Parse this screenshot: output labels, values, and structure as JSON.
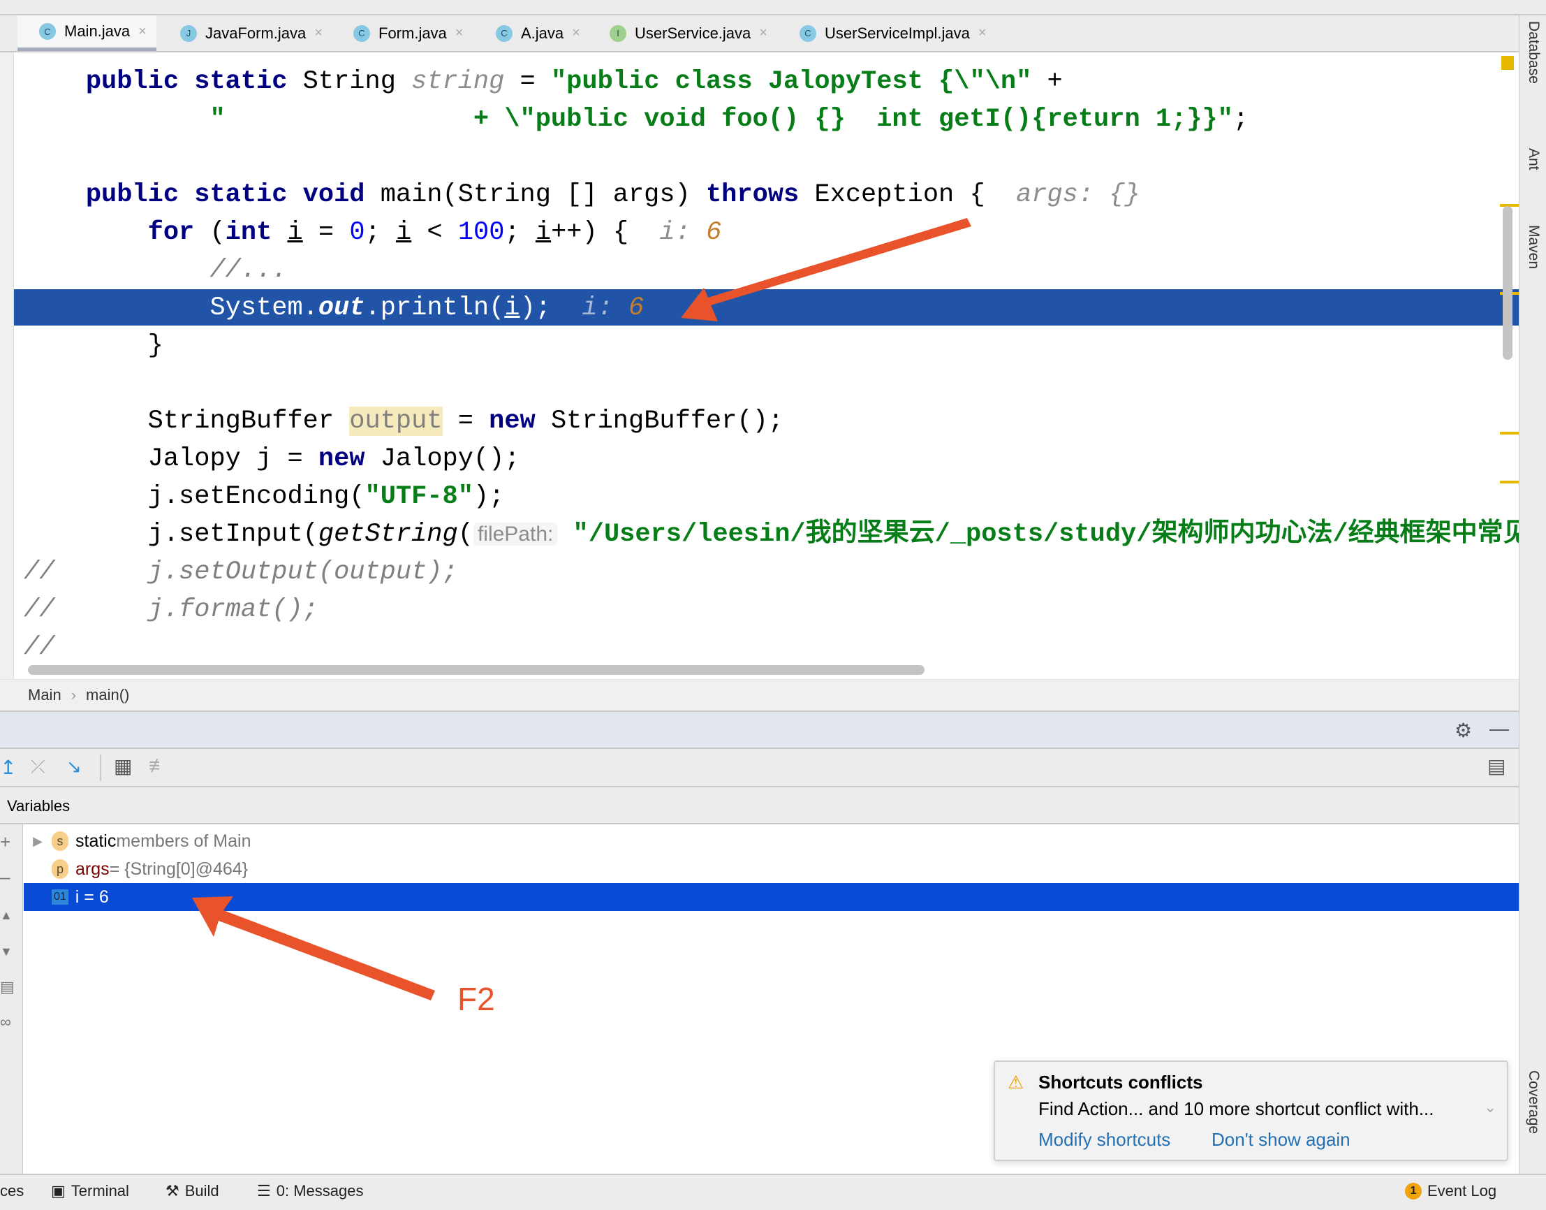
{
  "tabs": [
    {
      "label": "Main.java",
      "icon": "C",
      "icon_color": "#87c9e3",
      "active": true
    },
    {
      "label": "JavaForm.java",
      "icon": "J",
      "icon_color": "#87c9e3"
    },
    {
      "label": "Form.java",
      "icon": "C",
      "icon_color": "#87c9e3"
    },
    {
      "label": "A.java",
      "icon": "C",
      "icon_color": "#87c9e3"
    },
    {
      "label": "UserService.java",
      "icon": "I",
      "icon_color": "#9ecf8c"
    },
    {
      "label": "UserServiceImpl.java",
      "icon": "C",
      "icon_color": "#87c9e3"
    }
  ],
  "code": [
    [
      [
        "    public static ",
        "kw"
      ],
      [
        "String ",
        ""
      ],
      [
        "string",
        "hint"
      ],
      [
        " = ",
        ""
      ],
      [
        "\"public class JalopyTest {\\\"\\n\"",
        "str"
      ],
      [
        " +",
        ""
      ]
    ],
    [
      [
        "            \"                ",
        "str"
      ],
      [
        "+ \\\"public void foo() {}  int getI(){return 1;}}\"",
        "str"
      ],
      [
        ";",
        ""
      ]
    ],
    [],
    [
      [
        "    public static void ",
        "kw"
      ],
      [
        "main(String [] args) ",
        ""
      ],
      [
        "throws",
        "kw"
      ],
      [
        " Exception {  ",
        ""
      ],
      [
        "args: {}",
        "hint"
      ]
    ],
    [
      [
        "        for ",
        "kw"
      ],
      [
        "(",
        ""
      ],
      [
        "int ",
        "kw"
      ],
      [
        "i",
        "u"
      ],
      [
        " = ",
        ""
      ],
      [
        "0",
        "num"
      ],
      [
        "; ",
        ""
      ],
      [
        "i",
        "u"
      ],
      [
        " < ",
        ""
      ],
      [
        "100",
        "num"
      ],
      [
        "; ",
        ""
      ],
      [
        "i",
        "u"
      ],
      [
        "++) {  ",
        ""
      ],
      [
        "i: ",
        "hint"
      ],
      [
        "6",
        "hv"
      ]
    ],
    [
      [
        "            //...",
        "cm"
      ]
    ],
    [
      [
        "            System.",
        "w"
      ],
      [
        "out",
        "wi"
      ],
      [
        ".println(",
        "w"
      ],
      [
        "i",
        "w u"
      ],
      [
        ");  ",
        "w"
      ],
      [
        "i: ",
        "hintw"
      ],
      [
        "6",
        "hv"
      ]
    ],
    [
      [
        "        }",
        ""
      ]
    ],
    [],
    [
      [
        "        StringBuffer ",
        ""
      ],
      [
        "output",
        "sel"
      ],
      [
        " = ",
        ""
      ],
      [
        "new ",
        "kw"
      ],
      [
        "StringBuffer();",
        ""
      ]
    ],
    [
      [
        "        Jalopy j = ",
        ""
      ],
      [
        "new ",
        "kw"
      ],
      [
        "Jalopy();",
        ""
      ]
    ],
    [
      [
        "        j.setEncoding(",
        ""
      ],
      [
        "\"UTF-8\"",
        "str"
      ],
      [
        ");",
        ""
      ]
    ],
    [
      [
        "        j.setInput(",
        ""
      ],
      [
        "getString",
        "it"
      ],
      [
        "(",
        ""
      ],
      [
        "filePath:",
        "ph"
      ],
      [
        " \"/Users/leesin/我的坚果云/_posts/study/架构师内功心法/经典框架中常见",
        "str"
      ]
    ],
    [
      [
        "//      j.setOutput(output);",
        "cm"
      ]
    ],
    [
      [
        "//      j.format();",
        "cm"
      ]
    ],
    [
      [
        "//",
        "cm"
      ]
    ]
  ],
  "breadcrumb": [
    "Main",
    "main()"
  ],
  "variables": {
    "header": "Variables",
    "rows": [
      {
        "badge": "s",
        "name": "static",
        "rest": " members of Main"
      },
      {
        "badge": "p",
        "name": "args",
        "rest": " = {String[0]@464}"
      },
      {
        "badge": "01",
        "name": "i = 6",
        "rest": "",
        "selected": true
      }
    ]
  },
  "annotation": {
    "label": "F2",
    "color": "#e9532b"
  },
  "right_tools": [
    "Database",
    "Ant",
    "Maven",
    "Coverage"
  ],
  "status": {
    "items": [
      "ces",
      "Terminal",
      "Build",
      "0: Messages"
    ],
    "event_log": "Event Log",
    "event_count": "1"
  },
  "notification": {
    "title": "Shortcuts conflicts",
    "body": "Find Action... and 10 more shortcut conflict with...",
    "links": [
      "Modify shortcuts",
      "Don't show again"
    ]
  },
  "colors": {
    "exec_line": "#2154a6",
    "selected_row": "#0a4bd6",
    "link": "#2470b3",
    "arrow": "#e9532b"
  }
}
